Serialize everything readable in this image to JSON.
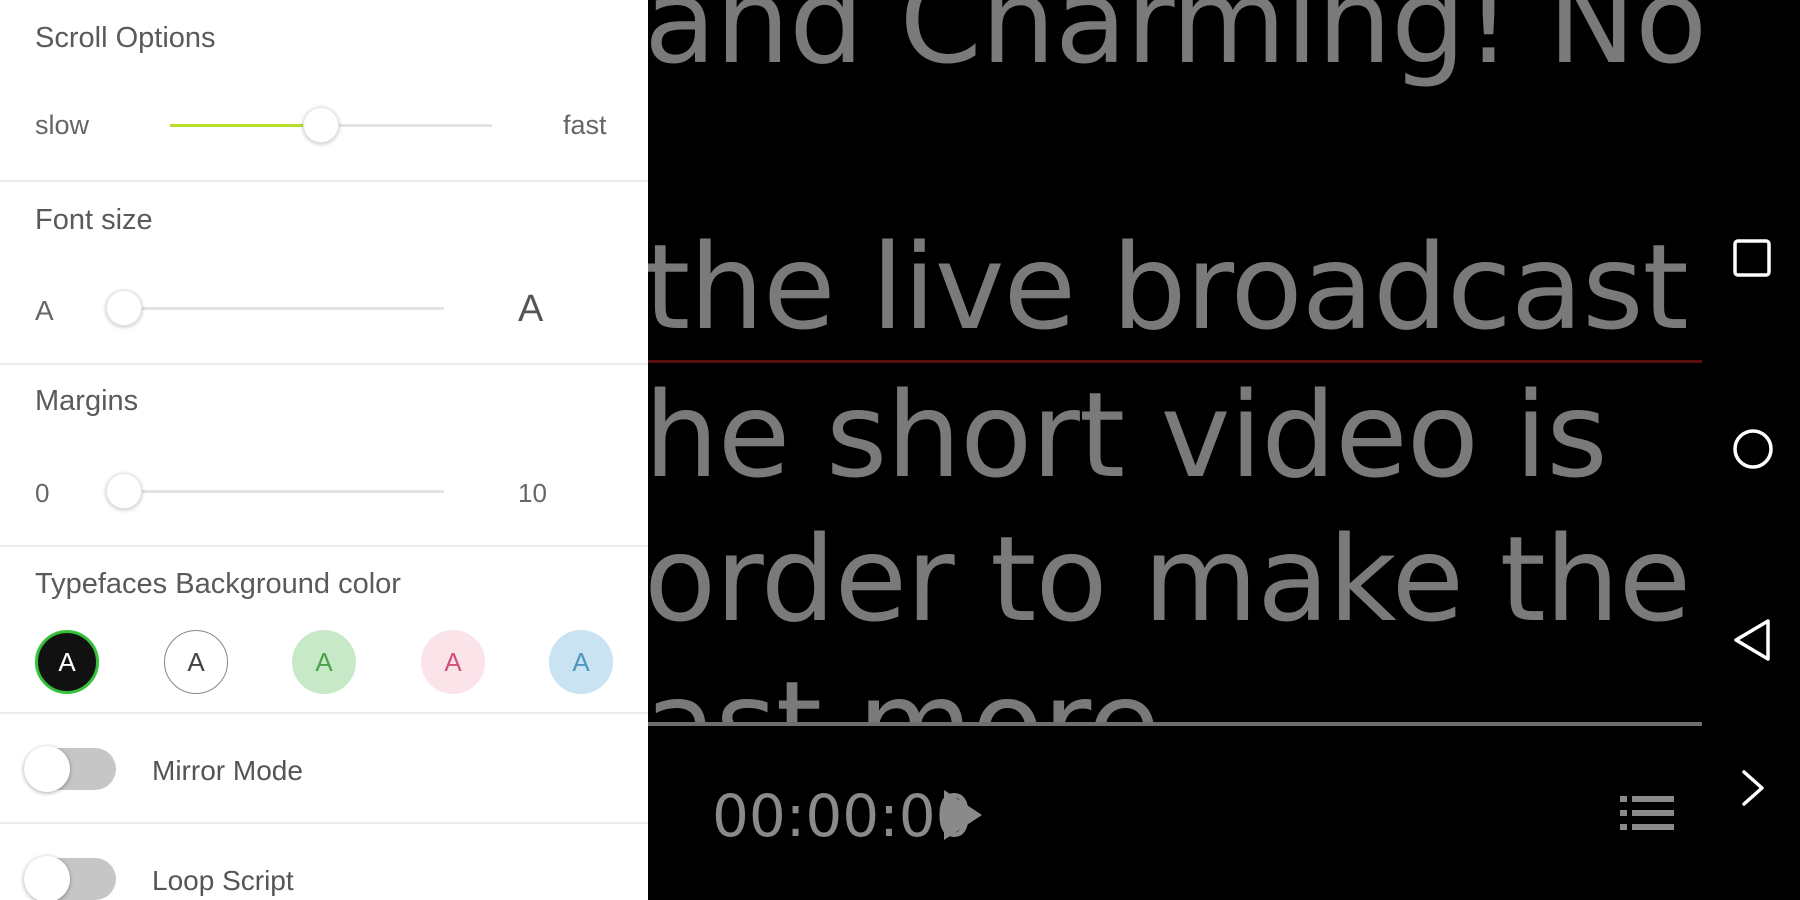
{
  "scroll_options": {
    "title": "Scroll Options",
    "min_label": "slow",
    "max_label": "fast",
    "value_fraction": 0.47
  },
  "font_size": {
    "title": "Font size",
    "min_label": "A",
    "max_label": "A",
    "value_fraction": 0.0
  },
  "margins": {
    "title": "Margins",
    "min_label": "0",
    "max_label": "10",
    "value": 0
  },
  "colors": {
    "title": "Typefaces Background color",
    "swatches": [
      {
        "label": "A",
        "bg": "#111111",
        "fg": "#ffffff",
        "border": "#35c23a",
        "selected": true
      },
      {
        "label": "A",
        "bg": "#ffffff",
        "fg": "#444444",
        "border": "#888888",
        "selected": false
      },
      {
        "label": "A",
        "bg": "#c8e9c8",
        "fg": "#4aa34a",
        "border": "#c8e9c8",
        "selected": false
      },
      {
        "label": "A",
        "bg": "#fbe3ea",
        "fg": "#d0527a",
        "border": "#fbe3ea",
        "selected": false
      },
      {
        "label": "A",
        "bg": "#c9e3f2",
        "fg": "#4d95c0",
        "border": "#c9e3f2",
        "selected": false
      }
    ]
  },
  "toggles": {
    "mirror": {
      "label": "Mirror Mode",
      "on": false
    },
    "loop": {
      "label": "Loop Script",
      "on": false
    }
  },
  "prompter": {
    "lines": [
      "and Charming! No",
      "the live broadcast",
      "he short video is",
      "order to make the",
      "ast more"
    ],
    "timer": "00:00:00"
  },
  "accent_color": "#b5df2b",
  "nav_icons": [
    "square-icon",
    "circle-icon",
    "back-triangle-icon",
    "chevron-right-icon"
  ]
}
